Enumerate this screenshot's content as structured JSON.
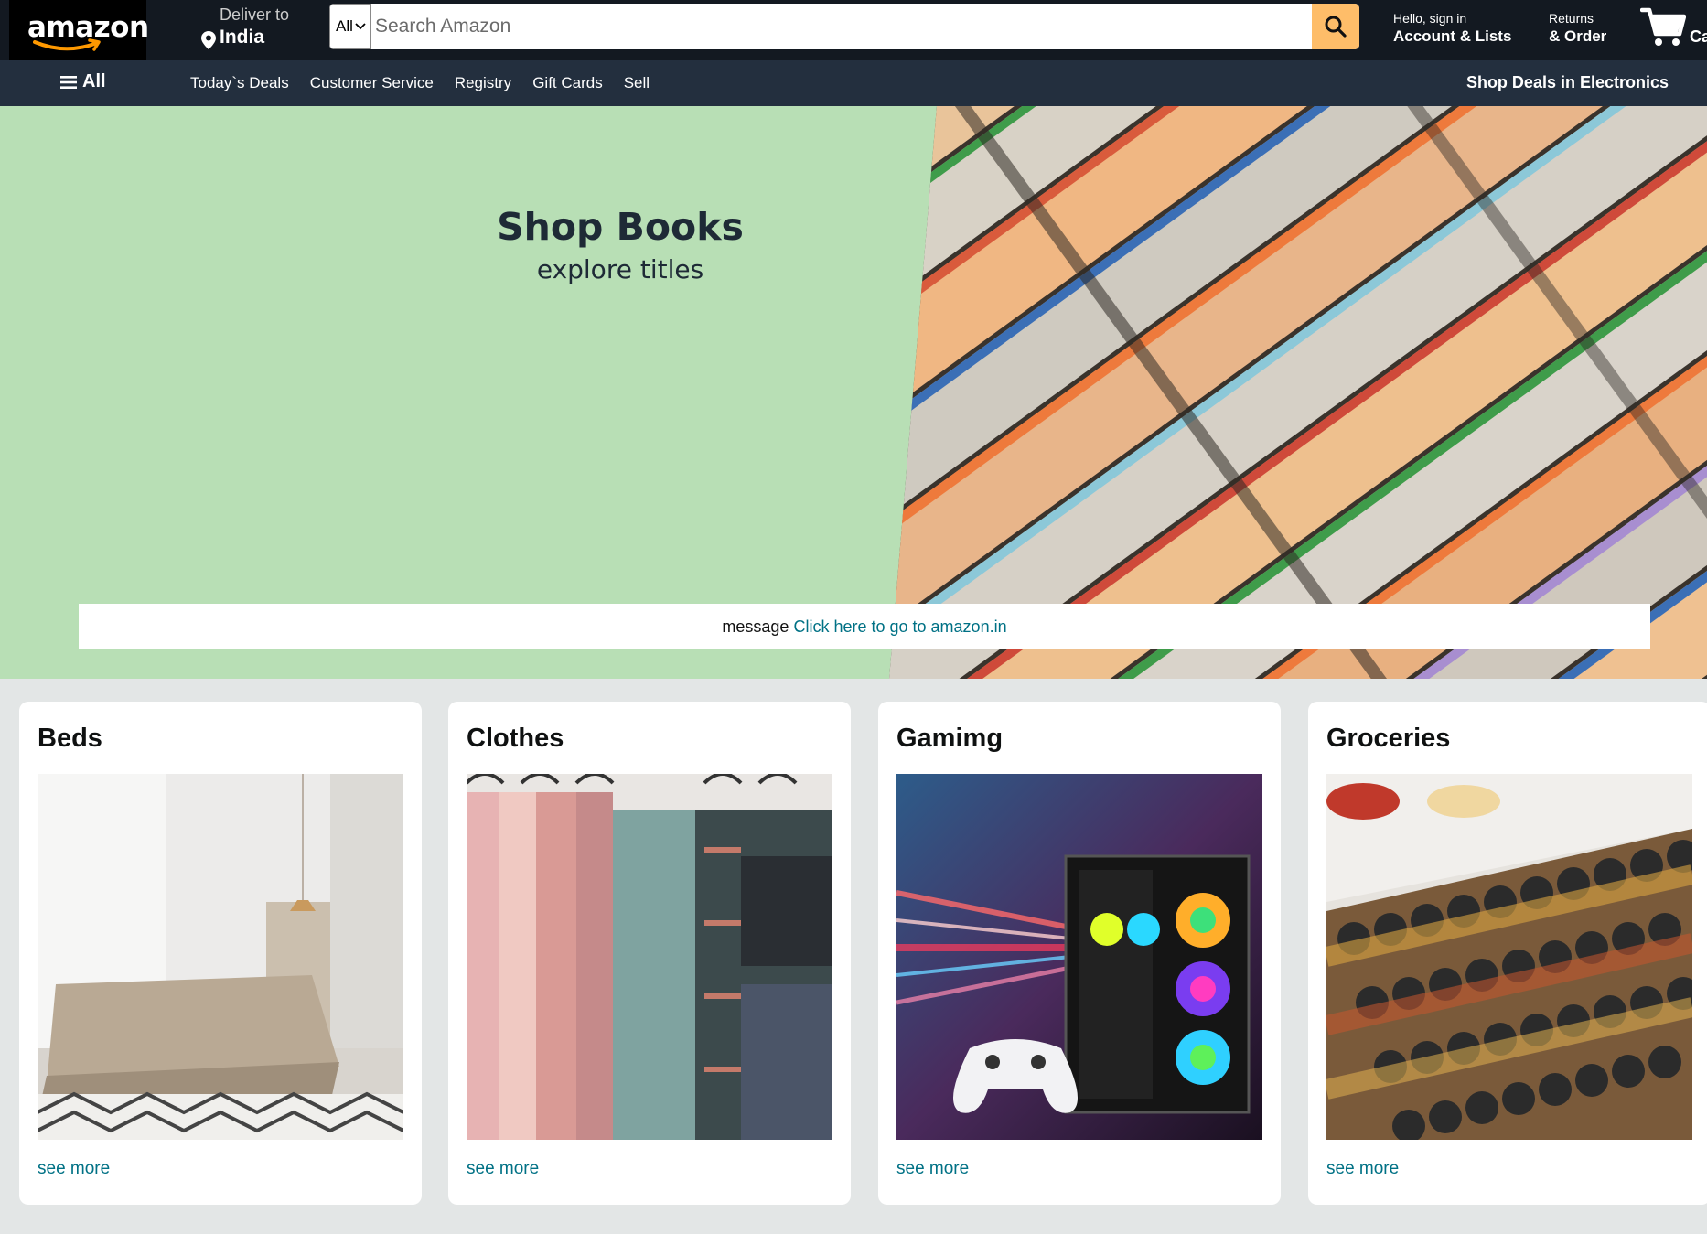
{
  "header": {
    "logo_text": "amazon",
    "deliver_label": "Deliver to",
    "deliver_location": "India",
    "search": {
      "category": "All",
      "placeholder": "Search Amazon"
    },
    "account": {
      "greeting": "Hello, sign in",
      "label": "Account & Lists"
    },
    "returns": {
      "line1": "Returns",
      "line2": "& Order"
    },
    "cart_label": "Ca"
  },
  "subnav": {
    "all_label": "All",
    "links": [
      "Today`s Deals",
      "Customer Service",
      "Registry",
      "Gift Cards",
      "Sell"
    ],
    "promo": "Shop Deals in Electronics"
  },
  "hero": {
    "title": "Shop Books",
    "subtitle": "explore titles",
    "message_prefix": "message",
    "message_link": "Click here to go to amazon.in"
  },
  "cards": [
    {
      "title": "Beds",
      "link": "see more"
    },
    {
      "title": "Clothes",
      "link": "see more"
    },
    {
      "title": "Gamimg",
      "link": "see more"
    },
    {
      "title": "Groceries",
      "link": "see more"
    }
  ],
  "colors": {
    "nav_top": "#131921",
    "nav_sub": "#232f3e",
    "search_button": "#febd69",
    "hero_bg": "#b8dfb5",
    "link": "#007185",
    "page_bg": "#e3e6e6"
  },
  "icons": [
    "location-pin-icon",
    "chevron-down-icon",
    "search-icon",
    "cart-icon",
    "hamburger-menu-icon"
  ]
}
